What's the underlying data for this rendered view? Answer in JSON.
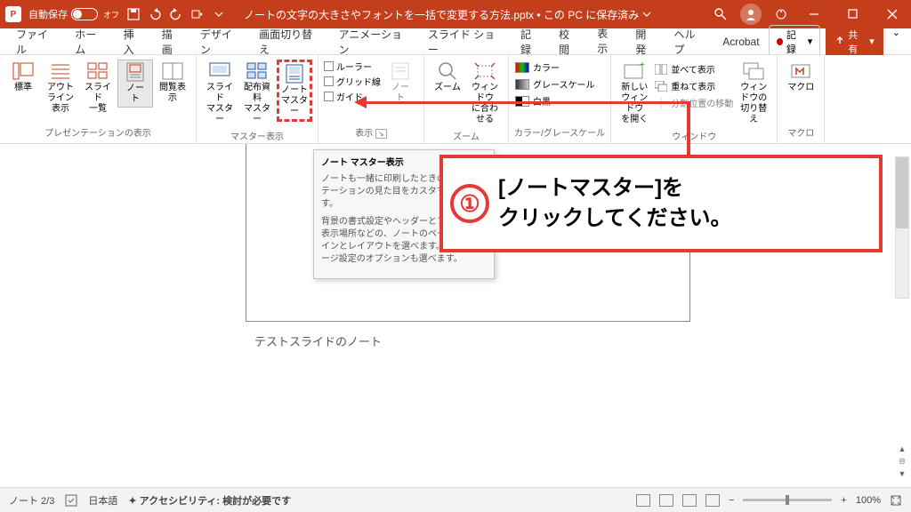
{
  "titlebar": {
    "autosave_label": "自動保存",
    "autosave_state": "オフ",
    "title": "ノートの文字の大きさやフォントを一括で変更する方法.pptx • この PC に保存済み"
  },
  "tabs": {
    "items": [
      "ファイル",
      "ホーム",
      "挿入",
      "描画",
      "デザイン",
      "画面切り替え",
      "アニメーション",
      "スライド ショー",
      "記録",
      "校閲",
      "表示",
      "開発",
      "ヘルプ",
      "Acrobat"
    ],
    "active": "表示",
    "record": "記録",
    "share": "共有"
  },
  "ribbon": {
    "group_presentation": {
      "label": "プレゼンテーションの表示",
      "normal": "標準",
      "outline": "アウトライン\n表示",
      "sorter": "スライド\n一覧",
      "notes": "ノー\nト",
      "reading": "閲覧表示"
    },
    "group_master": {
      "label": "マスター表示",
      "slide": "スライド\nマスター",
      "handout": "配布資料\nマスター",
      "note": "ノート\nマスター"
    },
    "group_show": {
      "label": "表示",
      "ruler": "ルーラー",
      "gridlines": "グリッド線",
      "guides": "ガイド",
      "notes_btn": "ノー\nト"
    },
    "group_zoom": {
      "label": "ズーム",
      "zoom": "ズーム",
      "fit": "ウィンドウ\nに合わせる"
    },
    "group_color": {
      "label": "カラー/グレースケール",
      "color": "カラー",
      "gray": "グレースケール",
      "bw": "白黒"
    },
    "group_window": {
      "label": "ウィンドウ",
      "new": "新しいウィンドウ\nを開く",
      "arrange": "並べて表示",
      "cascade": "重ねて表示",
      "split": "分割位置の移動",
      "switch": "ウィンドウの\n切り替え"
    },
    "group_macro": {
      "label": "マクロ",
      "macro": "マクロ"
    }
  },
  "tooltip": {
    "title": "ノート マスター表示",
    "body1": "ノートも一緒に印刷したときのプレゼンテーションの見た目をカスタマイズします。",
    "body2": "背景の書式設定やヘッダーとフッターの表示場所などの、ノートのページのデザインとレイアウトを選べます。また、ページ設定のオプションも選べます。"
  },
  "callout": {
    "num": "①",
    "text": "[ノートマスター]を\nクリックしてください。"
  },
  "canvas": {
    "note_text": "テストスライドのノート"
  },
  "statusbar": {
    "page": "ノート 2/3",
    "lang": "日本語",
    "a11y": "アクセシビリティ: 検討が必要です",
    "zoom": "100%"
  }
}
